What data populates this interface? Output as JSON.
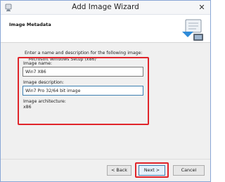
{
  "window": {
    "title": "Add Image Wizard",
    "close_glyph": "✕"
  },
  "header": {
    "title": "Image Metadata",
    "graphic": "wizard-graphic-icon"
  },
  "content": {
    "intro_line1": "Enter a name and description for the following image:",
    "intro_line2": "'Microsoft Windows Setup (x86)'",
    "image_name_label": "Image name:",
    "image_name_value": "Win7 X86",
    "image_description_label": "Image description:",
    "image_description_value": "Win7 Pro 32/64 bit image",
    "image_architecture_label": "Image architecture:",
    "image_architecture_value": "x86"
  },
  "footer": {
    "back_label": "< Back",
    "next_label": "Next >",
    "cancel_label": "Cancel"
  },
  "colors": {
    "highlight": "#e0252b",
    "window_border": "#8aa7d6",
    "focus_border": "#3c7fb1"
  }
}
